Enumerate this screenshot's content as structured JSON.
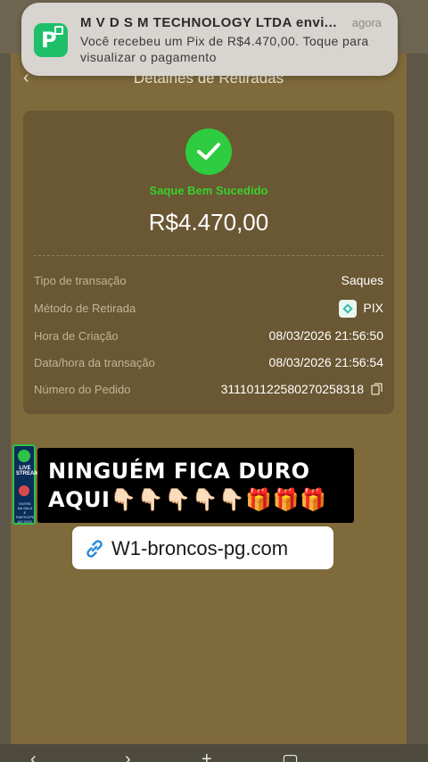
{
  "notification": {
    "title": "M V D S M TECHNOLOGY LTDA envi...",
    "time": "agora",
    "body": "Você recebeu um Pix de R$4.470,00. Toque para visualizar o pagamento",
    "icon": "picpay-app-icon"
  },
  "header": {
    "title": "Detalhes de Retiradas",
    "back_icon": "back-arrow-icon"
  },
  "card": {
    "status_icon": "check-circle-icon",
    "status_text": "Saque Bem Sucedido",
    "amount": "R$4.470,00",
    "rows": [
      {
        "label": "Tipo de transação",
        "value": "Saques"
      },
      {
        "label": "Método de Retirada",
        "value": "PIX"
      },
      {
        "label": "Hora de Criação",
        "value": "08/03/2026 21:56:50"
      },
      {
        "label": "Data/hora da transação",
        "value": "08/03/2026 21:56:54"
      },
      {
        "label": "Número do Pedido",
        "value": "311101122580270258318"
      }
    ]
  },
  "overlay": {
    "live_badge": "LIVE STREAM",
    "live_small_text": "ENTRE NA SALA E PARTICIPE AO VIVO",
    "promo_text": "NINGUÉM FICA DURO AQUI👇🏻👇🏻👇🏻👇🏻👇🏻🎁🎁🎁",
    "link_text": "W1-broncos-pg.com",
    "link_icon": "link-icon"
  },
  "colors": {
    "screen_bg": "#7f6a3b",
    "card_bg": "#6a5733",
    "success_green": "#2ecc40",
    "notification_bg": "#d8d4cf"
  }
}
